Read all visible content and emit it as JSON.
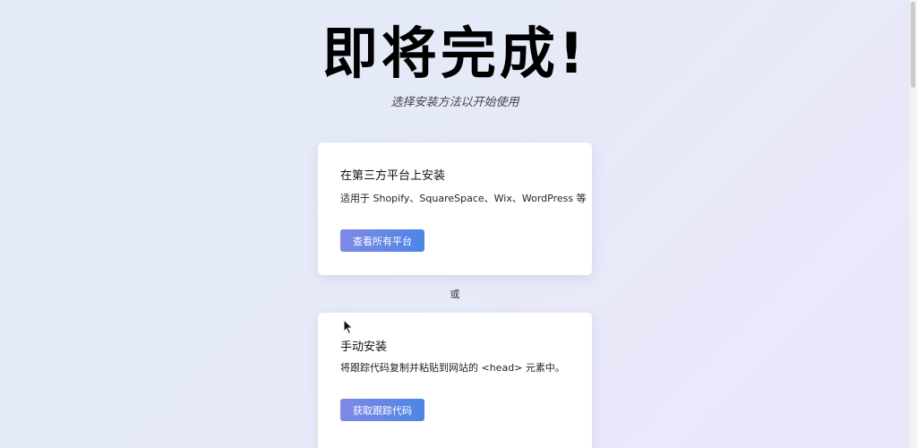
{
  "page": {
    "heading": "即将完成!",
    "subtitle": "选择安装方法以开始使用",
    "separator": "或"
  },
  "cards": [
    {
      "title": "在第三方平台上安装",
      "description": "适用于 Shopify、SquareSpace、Wix、WordPress 等",
      "button_label": "查看所有平台"
    },
    {
      "title": "手动安装",
      "description": "将跟踪代码复制并粘贴到网站的 <head> 元素中。",
      "button_label": "获取跟踪代码"
    }
  ],
  "colors": {
    "button_gradient_start": "#7f88e6",
    "button_gradient_end": "#4c86e6",
    "card_background": "#ffffff"
  },
  "icons": {
    "cursor": "mouse-pointer-icon"
  }
}
